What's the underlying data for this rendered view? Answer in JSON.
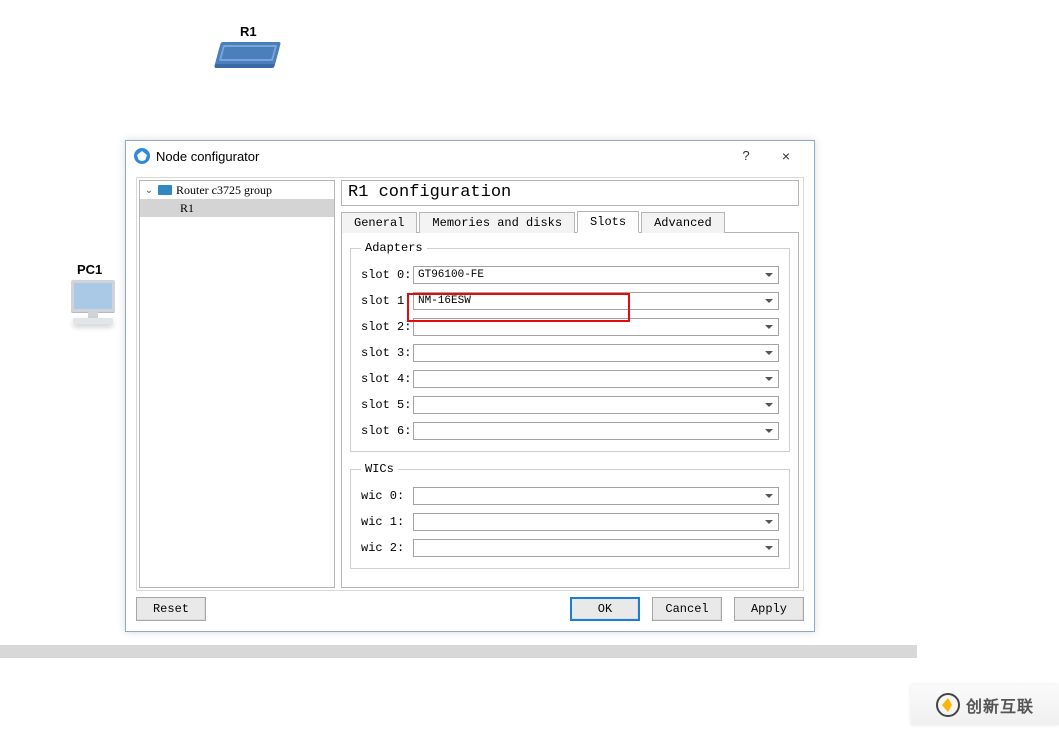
{
  "canvas": {
    "router_label": "R1",
    "pc_label": "PC1"
  },
  "dialog": {
    "title": "Node configurator",
    "help": "?",
    "close": "×",
    "tree": {
      "group": "Router c3725 group",
      "node": "R1"
    },
    "heading": "R1 configuration",
    "tabs": {
      "general": "General",
      "memories": "Memories and disks",
      "slots": "Slots",
      "advanced": "Advanced"
    },
    "adapters_legend": "Adapters",
    "wics_legend": "WICs",
    "slots": [
      {
        "label": "slot 0:",
        "value": "GT96100-FE"
      },
      {
        "label": "slot 1:",
        "value": "NM-16ESW"
      },
      {
        "label": "slot 2:",
        "value": ""
      },
      {
        "label": "slot 3:",
        "value": ""
      },
      {
        "label": "slot 4:",
        "value": ""
      },
      {
        "label": "slot 5:",
        "value": ""
      },
      {
        "label": "slot 6:",
        "value": ""
      }
    ],
    "wics": [
      {
        "label": "wic 0:",
        "value": ""
      },
      {
        "label": "wic 1:",
        "value": ""
      },
      {
        "label": "wic 2:",
        "value": ""
      }
    ],
    "buttons": {
      "reset": "Reset",
      "ok": "OK",
      "cancel": "Cancel",
      "apply": "Apply"
    }
  },
  "watermark": "创新互联"
}
